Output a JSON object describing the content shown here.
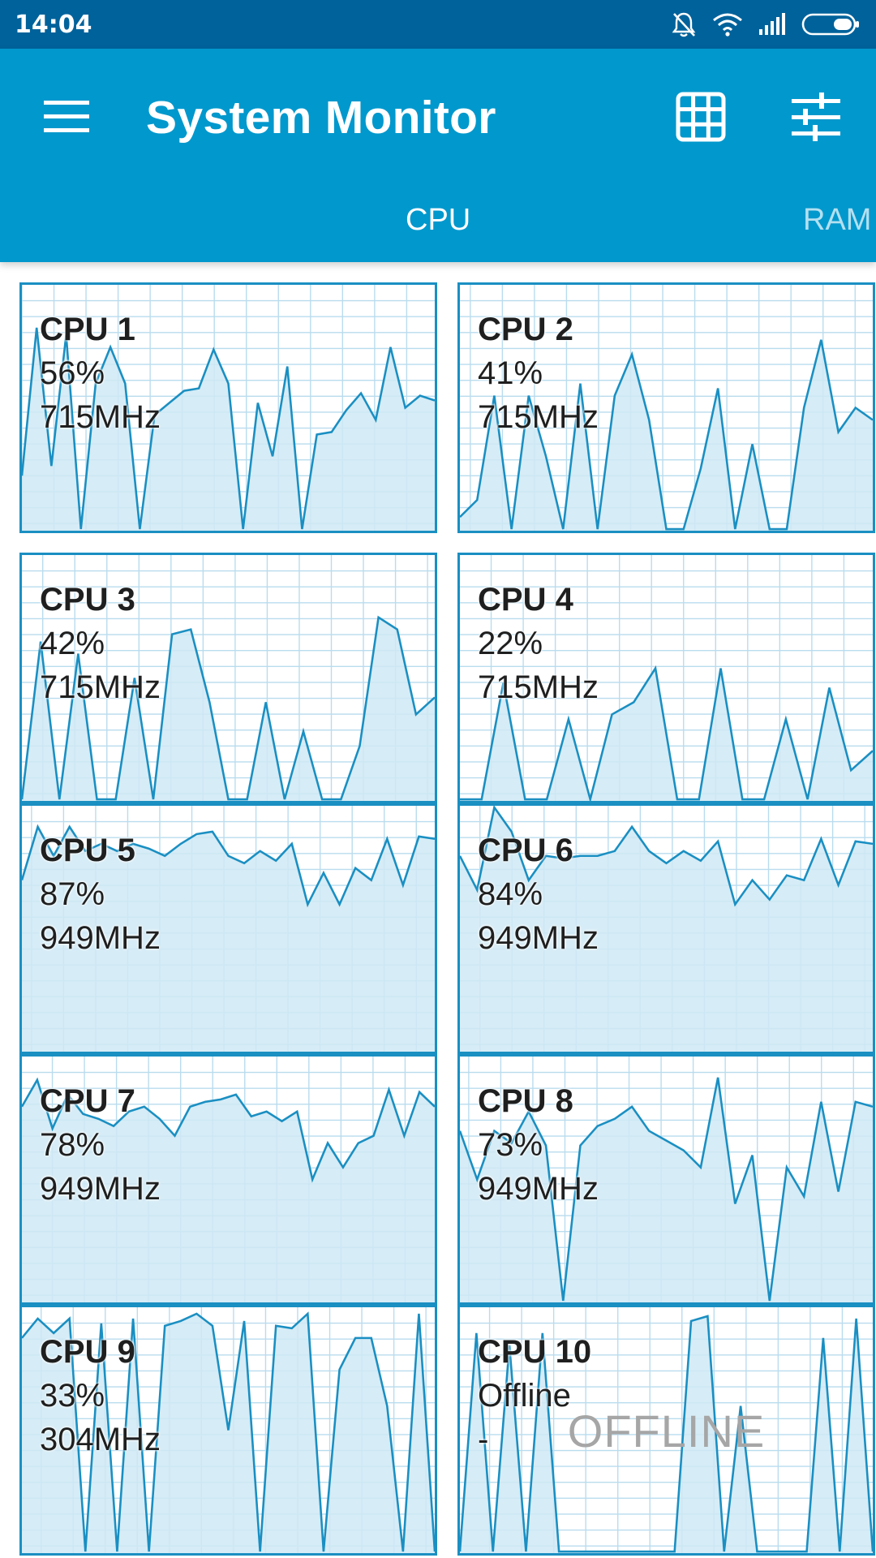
{
  "status_bar": {
    "time": "14:04",
    "icons": [
      "mute-bell-icon",
      "wifi-icon",
      "signal-icon",
      "battery-icon"
    ]
  },
  "app_bar": {
    "title": "System Monitor",
    "menu_icon": "hamburger-menu-icon",
    "grid_icon": "grid-view-icon",
    "tune_icon": "tune-settings-icon"
  },
  "tabs": [
    {
      "label": "CPU",
      "selected": true
    },
    {
      "label": "RAM",
      "selected": false
    }
  ],
  "colors": {
    "status_bar": "#00629b",
    "app_bar": "#0098cd",
    "chart_line": "#1a8fc2",
    "chart_fill": "#cfe9f4",
    "grid_line": "#b9dcee"
  },
  "cpus": [
    {
      "name": "CPU 1",
      "load": "56%",
      "freq": "715MHz",
      "offline": false,
      "history": [
        22,
        83,
        26,
        80,
        0,
        60,
        75,
        60,
        0,
        47,
        52,
        57,
        58,
        74,
        60,
        0,
        52,
        30,
        67,
        0,
        39,
        40,
        49,
        56,
        45,
        75,
        50,
        55,
        53
      ]
    },
    {
      "name": "CPU 2",
      "load": "41%",
      "freq": "715MHz",
      "offline": false,
      "history": [
        5,
        12,
        55,
        0,
        55,
        30,
        0,
        60,
        0,
        55,
        72,
        45,
        0,
        0,
        25,
        58,
        0,
        35,
        0,
        0,
        50,
        78,
        40,
        50,
        45
      ]
    },
    {
      "name": "CPU 3",
      "load": "42%",
      "freq": "715MHz",
      "offline": false,
      "history": [
        0,
        65,
        0,
        60,
        0,
        0,
        50,
        0,
        68,
        70,
        40,
        0,
        0,
        40,
        0,
        28,
        0,
        0,
        22,
        75,
        70,
        35,
        42
      ]
    },
    {
      "name": "CPU 4",
      "load": "22%",
      "freq": "715MHz",
      "offline": false,
      "history": [
        0,
        0,
        48,
        0,
        0,
        33,
        0,
        35,
        40,
        54,
        0,
        0,
        54,
        0,
        0,
        33,
        0,
        46,
        12,
        20
      ]
    },
    {
      "name": "CPU 5",
      "load": "87%",
      "freq": "949MHz",
      "offline": false,
      "history": [
        70,
        92,
        80,
        92,
        82,
        85,
        82,
        85,
        83,
        80,
        85,
        89,
        90,
        80,
        77,
        82,
        78,
        85,
        60,
        73,
        60,
        75,
        70,
        87,
        68,
        88,
        87
      ]
    },
    {
      "name": "CPU 6",
      "load": "84%",
      "freq": "949MHz",
      "offline": false,
      "history": [
        80,
        66,
        100,
        90,
        70,
        80,
        79,
        80,
        80,
        82,
        92,
        82,
        77,
        82,
        78,
        86,
        60,
        70,
        62,
        72,
        70,
        87,
        68,
        86,
        85
      ]
    },
    {
      "name": "CPU 7",
      "load": "78%",
      "freq": "949MHz",
      "offline": false,
      "history": [
        80,
        91,
        71,
        85,
        77,
        75,
        72,
        78,
        80,
        75,
        68,
        80,
        82,
        83,
        85,
        76,
        78,
        74,
        78,
        50,
        65,
        55,
        65,
        68,
        87,
        68,
        86,
        80
      ]
    },
    {
      "name": "CPU 8",
      "load": "73%",
      "freq": "949MHz",
      "offline": false,
      "history": [
        70,
        50,
        70,
        65,
        78,
        64,
        0,
        64,
        72,
        75,
        80,
        70,
        66,
        62,
        55,
        92,
        40,
        60,
        0,
        55,
        43,
        82,
        45,
        82,
        80
      ]
    },
    {
      "name": "CPU 9",
      "load": "33%",
      "freq": "304MHz",
      "offline": false,
      "history": [
        88,
        96,
        90,
        96,
        0,
        94,
        0,
        96,
        0,
        93,
        95,
        98,
        93,
        50,
        95,
        0,
        93,
        92,
        98,
        0,
        75,
        88,
        88,
        60,
        0,
        98,
        0
      ]
    },
    {
      "name": "CPU 10",
      "load": "Offline",
      "freq": "-",
      "offline": true,
      "watermark": "OFFLINE",
      "history": [
        0,
        90,
        0,
        85,
        0,
        90,
        0,
        0,
        0,
        0,
        0,
        0,
        0,
        0,
        95,
        97,
        0,
        60,
        0,
        0,
        0,
        0,
        88,
        0,
        96,
        0
      ]
    }
  ]
}
